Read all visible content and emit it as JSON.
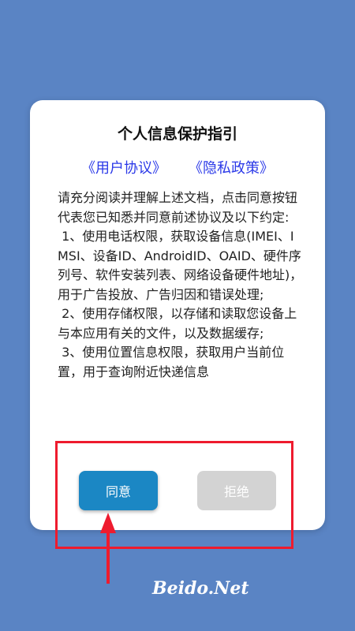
{
  "dialog": {
    "title": "个人信息保护指引",
    "link_user_agreement": "《用户协议》",
    "link_privacy_policy": "《隐私政策》",
    "body": "请充分阅读并理解上述文档，点击同意按钮代表您已知悉并同意前述协议及以下约定:\n 1、使用电话权限，获取设备信息(IMEI、IMSI、设备ID、AndroidID、OAID、硬件序列号、软件安装列表、网络设备硬件地址)，用于广告投放、广告归因和错误处理;\n 2、使用存储权限，以存储和读取您设备上与本应用有关的文件，以及数据缓存;\n 3、使用位置信息权限，获取用户当前位置，用于查询附近快递信息",
    "agree_label": "同意",
    "refuse_label": "拒绝"
  },
  "watermark": "Beido.Net",
  "colors": {
    "background": "#5a84c4",
    "agree_button": "#1b87c4",
    "refuse_button": "#d3d3d3",
    "link": "#2b39e8",
    "annotation": "#ee1b2e"
  }
}
